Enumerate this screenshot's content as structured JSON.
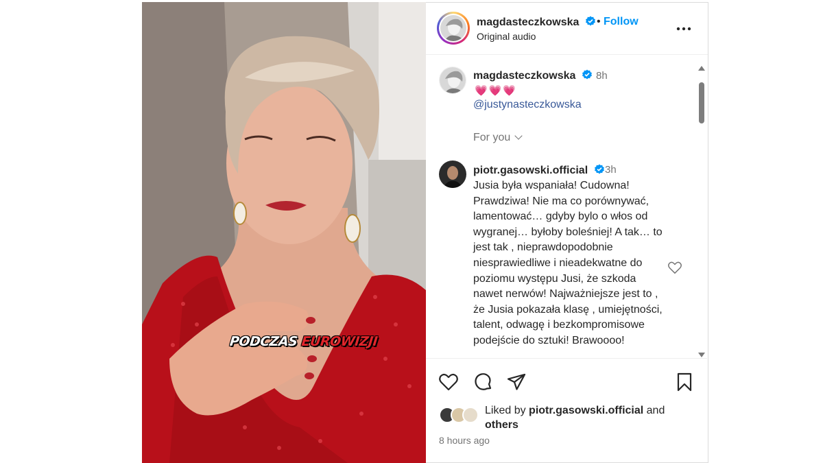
{
  "post": {
    "video_caption_part1": "PODCZAS",
    "video_caption_part2": "EUROWIZJI"
  },
  "header": {
    "username": "magdasteczkowska",
    "separator": "•",
    "follow_label": "Follow",
    "audio_label": "Original audio"
  },
  "caption": {
    "username": "magdasteczkowska",
    "time": "8h",
    "hearts": "💗💗💗",
    "mention": "@justynasteczkowska",
    "for_you_label": "For you"
  },
  "comment": {
    "username": "piotr.gasowski.official",
    "time": "3h",
    "text": "Jusia była wspaniała! Cudowna! Prawdziwa! Nie ma co porównywać, lamentować… gdyby bylo o włos od wygranej… byłoby boleśniej! A tak… to jest tak , nieprawdopodobnie niesprawiedliwe i nieadekwatne do poziomu występu Jusi, że szkoda nawet nerwów! Najważniejsze jest to , że Jusia pokazała klasę , umiejętności, talent, odwagę i bezkompromisowe podejście do sztuki! Brawoooo!"
  },
  "likes": {
    "prefix": "Liked by ",
    "user": "piotr.gasowski.official",
    "middle": " and ",
    "others": "others"
  },
  "timestamp": "8 hours ago",
  "colors": {
    "follow": "#0095f6",
    "mention": "#385898",
    "verified": "#0095f6",
    "dress": "#c0121c"
  },
  "icons": [
    "verified-badge-icon",
    "more-options-icon",
    "heart-icon",
    "comment-icon",
    "share-icon",
    "bookmark-icon",
    "chevron-down-icon"
  ]
}
